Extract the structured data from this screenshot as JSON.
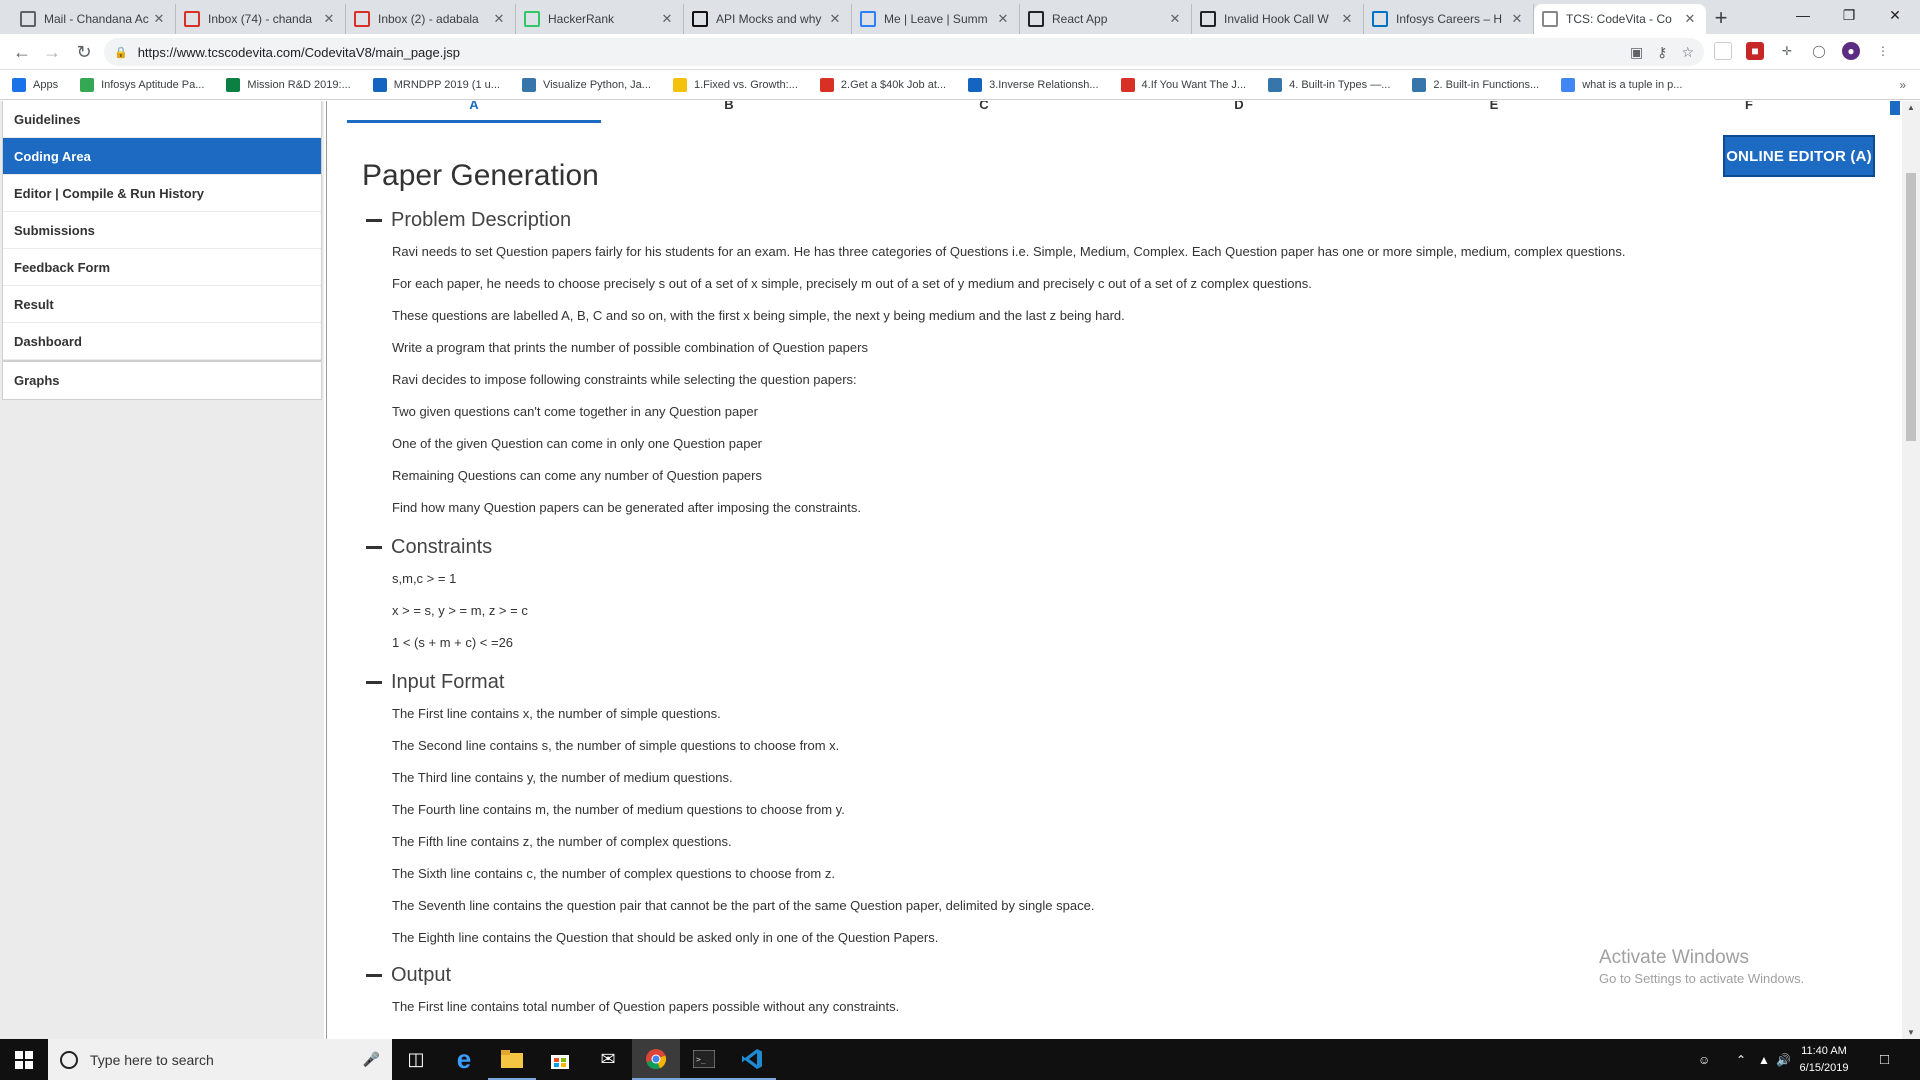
{
  "browser": {
    "tabs": [
      {
        "title": "Mail - Chandana Ac",
        "icon": "mail-icon",
        "color": "#5f6368"
      },
      {
        "title": "Inbox (74) - chanda",
        "icon": "gmail-icon",
        "color": "#d93025"
      },
      {
        "title": "Inbox (2) - adabala",
        "icon": "gmail-icon",
        "color": "#d93025"
      },
      {
        "title": "HackerRank",
        "icon": "hackerrank-icon",
        "color": "#2ec866"
      },
      {
        "title": "API Mocks and why",
        "icon": "medium-icon",
        "color": "#111111"
      },
      {
        "title": "Me | Leave | Summ",
        "icon": "keka-icon",
        "color": "#2d7ff9"
      },
      {
        "title": "React App",
        "icon": "react-app-icon",
        "color": "#20232a"
      },
      {
        "title": "Invalid Hook Call W",
        "icon": "react-docs-icon",
        "color": "#20232a"
      },
      {
        "title": "Infosys Careers – H",
        "icon": "infosys-icon",
        "color": "#0072c6"
      },
      {
        "title": "TCS: CodeVita - Co",
        "icon": "codevita-icon",
        "color": "#888888",
        "active": true
      }
    ],
    "new_tab_label": "+",
    "url": "https://www.tcscodevita.com/CodevitaV8/main_page.jsp",
    "bookmarks": [
      {
        "label": "Apps",
        "icon": "apps-grid-icon",
        "color": "#1a73e8"
      },
      {
        "label": "Infosys Aptitude Pa...",
        "icon": "bookmark-green-icon",
        "color": "#34a853"
      },
      {
        "label": "Mission R&D 2019:...",
        "icon": "bookmark-dash-icon",
        "color": "#0b8043"
      },
      {
        "label": "MRNDPP 2019 (1 u...",
        "icon": "bookmark-p-icon",
        "color": "#1565c0"
      },
      {
        "label": "Visualize Python, Ja...",
        "icon": "python-icon",
        "color": "#3776ab"
      },
      {
        "label": "1.Fixed vs. Growth:...",
        "icon": "bookmark-yellow-icon",
        "color": "#f4c20d"
      },
      {
        "label": "2.Get a $40k Job at...",
        "icon": "bookmark-p-red-icon",
        "color": "#d93025"
      },
      {
        "label": "3.Inverse Relationsh...",
        "icon": "bookmark-pt-icon",
        "color": "#1565c0"
      },
      {
        "label": "4.If You Want The J...",
        "icon": "bookmark-p-red-icon",
        "color": "#d93025"
      },
      {
        "label": "4. Built-in Types —...",
        "icon": "python-icon",
        "color": "#3776ab"
      },
      {
        "label": "2. Built-in Functions...",
        "icon": "python-icon",
        "color": "#3776ab"
      },
      {
        "label": "what is a tuple in p...",
        "icon": "google-icon",
        "color": "#4285f4"
      }
    ],
    "bookmarks_more": "»"
  },
  "sidebar": {
    "items": [
      {
        "label": "Guidelines",
        "active": false
      },
      {
        "label": "Coding Area",
        "active": true
      },
      {
        "label": "Editor | Compile & Run History",
        "active": false
      },
      {
        "label": "Submissions",
        "active": false
      },
      {
        "label": "Feedback Form",
        "active": false
      },
      {
        "label": "Result",
        "active": false
      },
      {
        "label": "Dashboard",
        "active": false
      }
    ],
    "graphs_label": "Graphs"
  },
  "main": {
    "question_tabs": [
      "A",
      "B",
      "C",
      "D",
      "E",
      "F"
    ],
    "active_tab": "A",
    "editor_button": "ONLINE EDITOR (A)",
    "title": "Paper Generation",
    "sections": [
      {
        "heading": "Problem Description",
        "lines": [
          "Ravi needs to set Question papers fairly for his students for an exam. He has three categories of Questions i.e. Simple, Medium, Complex. Each Question paper has one or more simple, medium, complex questions.",
          "For each paper, he needs to choose precisely s out of a set of x simple, precisely m out of a set of y medium and precisely c out of a set of z complex questions.",
          "These questions are labelled A, B, C and so on, with the first x being simple, the next y being medium and the last z being hard.",
          "Write a program that prints the number of possible combination of Question papers",
          "Ravi decides to impose following constraints while selecting the question papers:",
          "Two given questions can't come together in any Question paper",
          "One of the given Question can come in only one Question paper",
          "Remaining Questions can come any number of Question papers",
          "Find how many Question papers can be generated after imposing the constraints."
        ]
      },
      {
        "heading": "Constraints",
        "lines": [
          "s,m,c > = 1",
          "x > = s, y > = m, z > = c",
          "1 < (s + m + c) < =26"
        ]
      },
      {
        "heading": "Input Format",
        "lines": [
          "The First line contains x, the number of simple questions.",
          "The Second line contains s, the number of simple questions to choose from x.",
          "The Third line contains y, the number of medium questions.",
          "The Fourth line contains m, the number of medium questions to choose from y.",
          "The Fifth line contains z, the number of complex questions.",
          "The Sixth line contains c, the number of complex questions to choose from z.",
          "The Seventh line contains the question pair that cannot be the part of the same Question paper, delimited by single space.",
          "The Eighth line contains the Question that should be asked only in one of the Question Papers."
        ]
      },
      {
        "heading": "Output",
        "lines": [
          "The First line contains total number of Question papers possible without any constraints."
        ]
      }
    ],
    "watermark_title": "Activate Windows",
    "watermark_sub": "Go to Settings to activate Windows."
  },
  "taskbar": {
    "search_placeholder": "Type here to search",
    "apps": [
      "task-view-icon",
      "edge-icon",
      "file-explorer-icon",
      "store-icon",
      "mail-app-icon",
      "chrome-icon",
      "terminal-icon",
      "vscode-icon"
    ],
    "time": "11:40 AM",
    "date": "6/15/2019"
  },
  "colors": {
    "accent": "#1c6ac2",
    "taskbar": "#101010"
  }
}
